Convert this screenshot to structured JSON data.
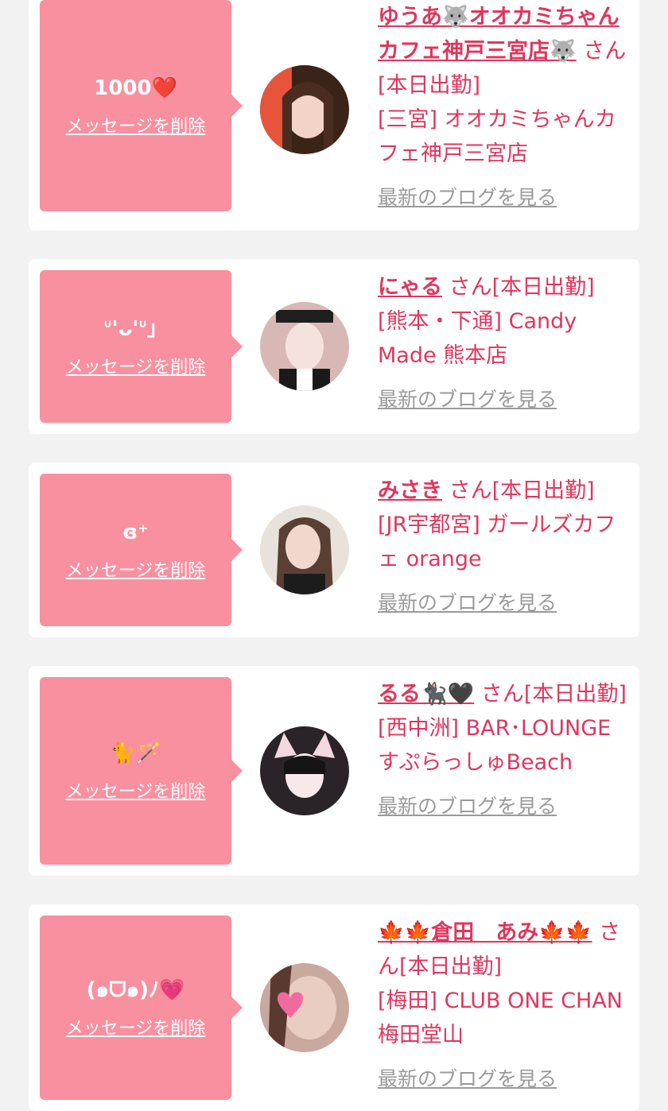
{
  "entries": [
    {
      "message": "1000❤️",
      "delete_label": "メッセージを削除",
      "name": "ゆうあ🐺オオカミちゃんカフェ神戸三宮店🐺",
      "suffix": "さん[本日出勤]",
      "shop": "[三宮] オオカミちゃんカフェ神戸三宮店",
      "blog_label": "最新のブログを見る"
    },
    {
      "message": "ᐡ'ᴗ'ᐡ」",
      "delete_label": "メッセージを削除",
      "name": "にゃる",
      "suffix": "さん[本日出勤]",
      "shop": "[熊本・下通] Candy Made 熊本店",
      "blog_label": "最新のブログを見る"
    },
    {
      "message": "ɞ⁺",
      "delete_label": "メッセージを削除",
      "name": "みさき",
      "suffix": "さん[本日出勤]",
      "shop": "[JR宇都宮] ガールズカフェ orange",
      "blog_label": "最新のブログを見る"
    },
    {
      "message": "🐈🪄",
      "delete_label": "メッセージを削除",
      "name": "るる🐈‍⬛🖤",
      "suffix": "さん[本日出勤]",
      "shop": "[西中洲] BAR･LOUNGE すぷらっしゅBeach",
      "blog_label": "最新のブログを見る"
    },
    {
      "message": "(๑ᗜ๑)ﾉ💗",
      "delete_label": "メッセージを削除",
      "name": "🍁🍁倉田　あみ🍁🍁",
      "suffix": "さん[本日出勤]",
      "shop": "[梅田] CLUB ONE CHAN 梅田堂山",
      "blog_label": "最新のブログを見る"
    }
  ],
  "colors": {
    "background": "#f2f2f2",
    "card": "#ffffff",
    "bubble": "#f890a0",
    "accent": "#e0365e",
    "link_gray": "#9a9a9a"
  },
  "icons": {
    "avatar": "profile-photo",
    "delete": "underlined-text-link"
  }
}
